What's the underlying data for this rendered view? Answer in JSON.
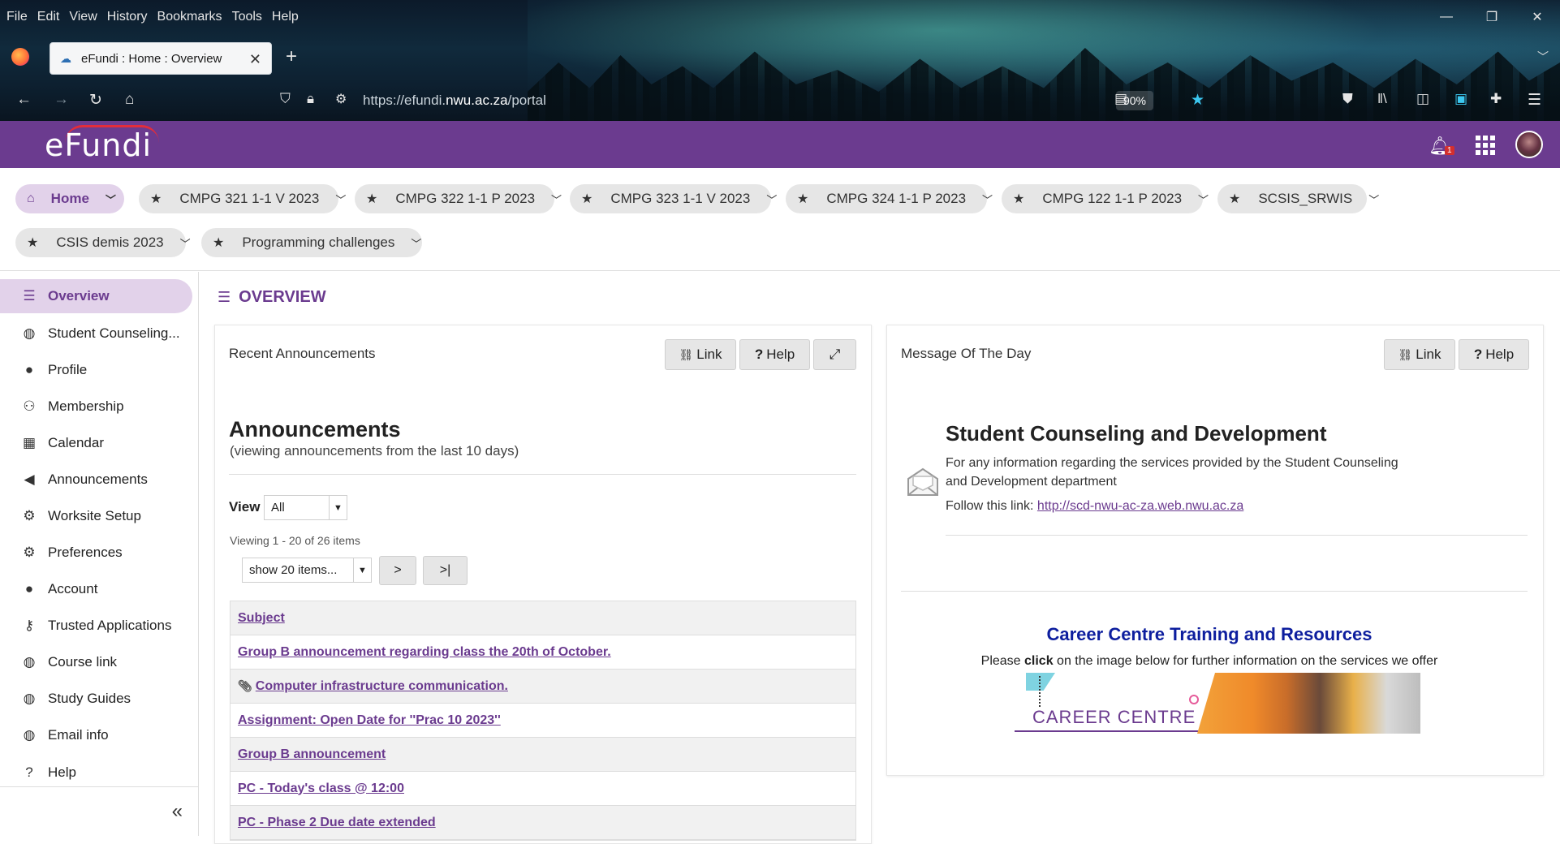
{
  "browser": {
    "menu": [
      "File",
      "Edit",
      "View",
      "History",
      "Bookmarks",
      "Tools",
      "Help"
    ],
    "tab_title": "eFundi : Home : Overview",
    "url_prefix": "https://efundi.",
    "url_domain": "nwu.ac.za",
    "url_path": "/portal",
    "zoom": "90%"
  },
  "header": {
    "logo": "eFundi",
    "notification_count": "1"
  },
  "site_tabs": [
    {
      "label": "Home"
    },
    {
      "label": "CMPG 321 1-1 V 2023"
    },
    {
      "label": "CMPG 322 1-1 P 2023"
    },
    {
      "label": "CMPG 323 1-1 V 2023"
    },
    {
      "label": "CMPG 324 1-1 P 2023"
    },
    {
      "label": "CMPG 122 1-1 P 2023"
    },
    {
      "label": "SCSIS_SRWIS"
    },
    {
      "label": "CSIS demis 2023"
    },
    {
      "label": "Programming challenges"
    }
  ],
  "sidebar": {
    "items": [
      {
        "label": "Overview",
        "icon": "list-icon"
      },
      {
        "label": "Student Counseling...",
        "icon": "globe-icon"
      },
      {
        "label": "Profile",
        "icon": "user-icon"
      },
      {
        "label": "Membership",
        "icon": "users-icon"
      },
      {
        "label": "Calendar",
        "icon": "calendar-icon"
      },
      {
        "label": "Announcements",
        "icon": "megaphone-icon"
      },
      {
        "label": "Worksite Setup",
        "icon": "cogs-icon"
      },
      {
        "label": "Preferences",
        "icon": "gear-icon"
      },
      {
        "label": "Account",
        "icon": "user-icon"
      },
      {
        "label": "Trusted Applications",
        "icon": "key-icon"
      },
      {
        "label": "Course link",
        "icon": "globe-icon"
      },
      {
        "label": "Study Guides",
        "icon": "globe-icon"
      },
      {
        "label": "Email info",
        "icon": "globe-icon"
      },
      {
        "label": "Help",
        "icon": "question-icon"
      }
    ]
  },
  "page_title": "OVERVIEW",
  "announcements_panel": {
    "title": "Recent Announcements",
    "link_btn": "Link",
    "help_btn": "Help",
    "heading": "Announcements",
    "subheading": "(viewing announcements from the last 10 days)",
    "view_label": "View",
    "view_value": "All",
    "viewing_text": "Viewing 1 - 20 of 26 items",
    "page_size": "show 20 items...",
    "next_btn": ">",
    "last_btn": ">|",
    "column_subject": "Subject",
    "rows": [
      "Group B announcement regarding class the 20th of October.",
      "Computer infrastructure communication.",
      "Assignment: Open Date for ''Prac 10 2023''",
      "Group B announcement",
      "PC - Today's class @ 12:00",
      "PC - Phase 2 Due date extended"
    ]
  },
  "motd_panel": {
    "title": "Message Of The Day",
    "link_btn": "Link",
    "help_btn": "Help",
    "heading": "Student Counseling and Development",
    "body": "For any information regarding the services provided by the Student Counseling and Development department",
    "follow_text": "Follow this link: ",
    "follow_link": "http://scd-nwu-ac-za.web.nwu.ac.za",
    "career_heading": "Career Centre Training and Resources",
    "career_pre": "Please ",
    "career_bold": "click",
    "career_post": " on the image below for further information on the services we offer",
    "banner_text": "CAREER CENTRE"
  }
}
